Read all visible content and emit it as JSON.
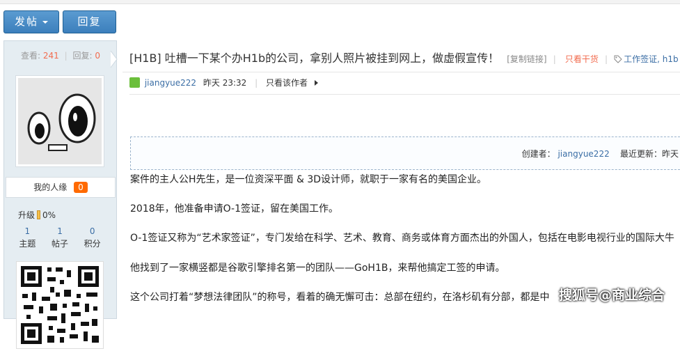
{
  "toolbar": {
    "post_label": "发帖",
    "reply_label": "回复"
  },
  "sidebar": {
    "views_label": "查看:",
    "views_value": "241",
    "replies_label": "回复:",
    "replies_value": "0",
    "renyuan_label": "我的人缘",
    "renyuan_value": "0",
    "level_label": "升级",
    "level_value": "0%",
    "counts": [
      {
        "value": "1",
        "label": "主题"
      },
      {
        "value": "1",
        "label": "帖子"
      },
      {
        "value": "0",
        "label": "积分"
      }
    ]
  },
  "thread": {
    "title": "[H1B] 吐槽一下某个办H1b的公司，拿别人照片被挂到网上，做虚假宣传！",
    "copy_link": "[复制链接]",
    "only_goods": "只看干货",
    "tags": "工作签证, h1b"
  },
  "author": {
    "name": "jiangyue222",
    "time": "昨天 23:32",
    "only_author": "只看该作者"
  },
  "creator_box": {
    "creator_label": "创建者：",
    "creator_name": "jiangyue222",
    "updated_label": "最近更新：昨天"
  },
  "content": {
    "p1": "案件的主人公H先生，是一位资深平面 & 3D设计师，就职于一家有名的美国企业。",
    "p2": "2018年，他准备申请O-1签证，留在美国工作。",
    "p3": "O-1签证又称为“艺术家签证”，专门发给在科学、艺术、教育、商务或体育方面杰出的外国人，包括在电影电视行业的国际大牛",
    "p4": "他找到了一家横竖都是谷歌引擎排名第一的团队——GoH1B，来帮他搞定工签的申请。",
    "p5": "这个公司打着“梦想法律团队”的称号，看着的确无懈可击：总部在纽约，在洛杉矶有分部，都是中"
  },
  "watermark": "搜狐号@商业综合"
}
